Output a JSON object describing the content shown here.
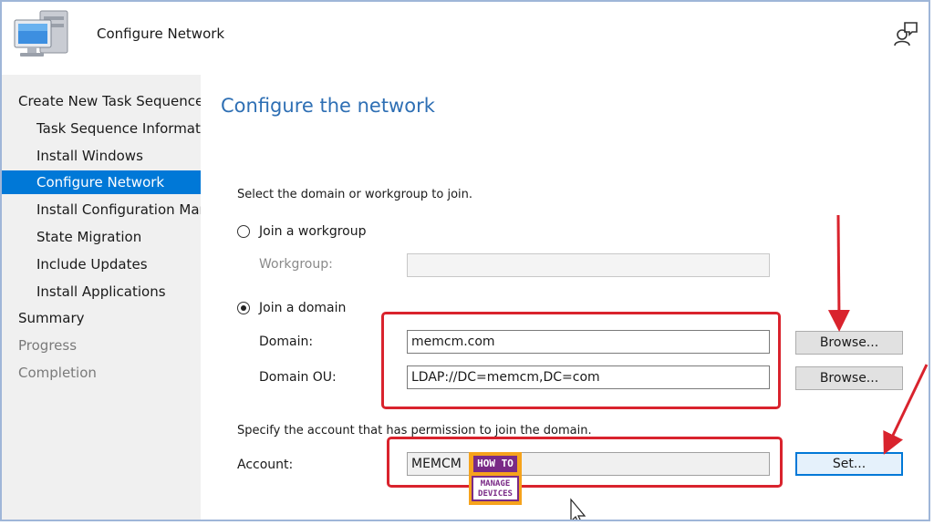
{
  "header": {
    "title": "Configure Network"
  },
  "sidebar": {
    "items": [
      {
        "label": "Create New Task Sequence",
        "level": 1,
        "state": "normal"
      },
      {
        "label": "Task Sequence Information",
        "level": 2,
        "state": "normal"
      },
      {
        "label": "Install Windows",
        "level": 2,
        "state": "normal"
      },
      {
        "label": "Configure Network",
        "level": 2,
        "state": "selected"
      },
      {
        "label": "Install Configuration Manager",
        "level": 2,
        "state": "normal"
      },
      {
        "label": "State Migration",
        "level": 2,
        "state": "normal"
      },
      {
        "label": "Include Updates",
        "level": 2,
        "state": "normal"
      },
      {
        "label": "Install Applications",
        "level": 2,
        "state": "normal"
      },
      {
        "label": "Summary",
        "level": 1,
        "state": "normal"
      },
      {
        "label": "Progress",
        "level": 1,
        "state": "disabled"
      },
      {
        "label": "Completion",
        "level": 1,
        "state": "disabled"
      }
    ]
  },
  "main": {
    "heading": "Configure the network",
    "instruction": "Select the domain or workgroup to join.",
    "workgroup_option": {
      "label": "Join a workgroup",
      "checked": false
    },
    "workgroup_field": {
      "label": "Workgroup:",
      "value": ""
    },
    "domain_option": {
      "label": "Join a domain",
      "checked": true
    },
    "domain_field": {
      "label": "Domain:",
      "value": "memcm.com"
    },
    "domain_browse": "Browse...",
    "ou_field": {
      "label": "Domain OU:",
      "value": "LDAP://DC=memcm,DC=com"
    },
    "ou_browse": "Browse...",
    "account_instruction": "Specify the account that has permission to join the domain.",
    "account_field": {
      "label": "Account:",
      "value": "MEMCM"
    },
    "set_button": "Set..."
  },
  "watermark": {
    "line1": "HOW TO",
    "line2": "MANAGE",
    "line3": "DEVICES"
  },
  "colors": {
    "accent": "#0078d7",
    "heading": "#2e6fb4",
    "highlight": "#d9232d",
    "logo_orange": "#f6a31c",
    "logo_purple": "#7a2a86"
  }
}
